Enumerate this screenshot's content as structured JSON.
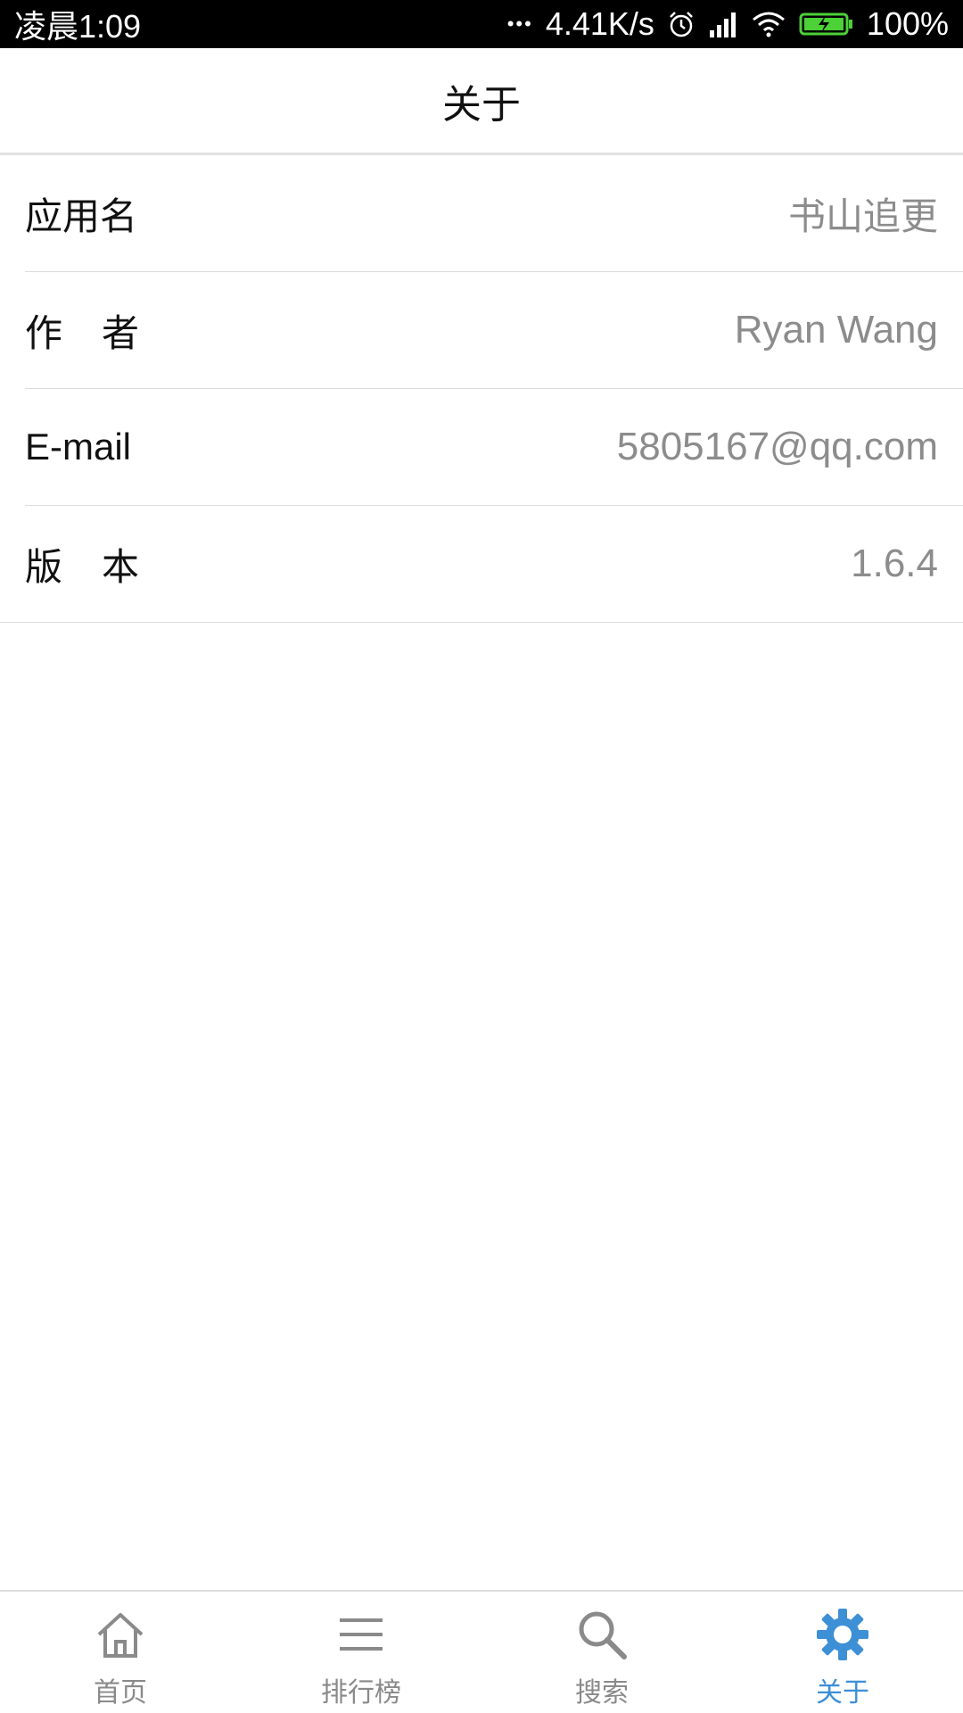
{
  "status_bar": {
    "time": "凌晨1:09",
    "more_dots": "•••",
    "net_speed": "4.41K/s",
    "battery": "100%",
    "icons": [
      "alarm-icon",
      "signal-icon",
      "wifi-icon",
      "battery-charging-icon"
    ]
  },
  "header": {
    "title": "关于"
  },
  "info": {
    "items": [
      {
        "label": "应用名",
        "value": "书山追更"
      },
      {
        "label": "作者",
        "value": "Ryan Wang"
      },
      {
        "label": "E-mail",
        "value": "5805167@qq.com"
      },
      {
        "label": "版本",
        "value": "1.6.4"
      }
    ]
  },
  "nav": {
    "items": [
      {
        "label": "首页",
        "icon": "home-icon"
      },
      {
        "label": "排行榜",
        "icon": "menu-lines-icon"
      },
      {
        "label": "搜索",
        "icon": "search-icon"
      },
      {
        "label": "关于",
        "icon": "gear-icon"
      }
    ],
    "active_index": 3
  },
  "colors": {
    "accent": "#3d8fd6",
    "inactive": "#8a8a8a",
    "value_text": "#8c8c8c",
    "battery_green": "#4cd137"
  }
}
